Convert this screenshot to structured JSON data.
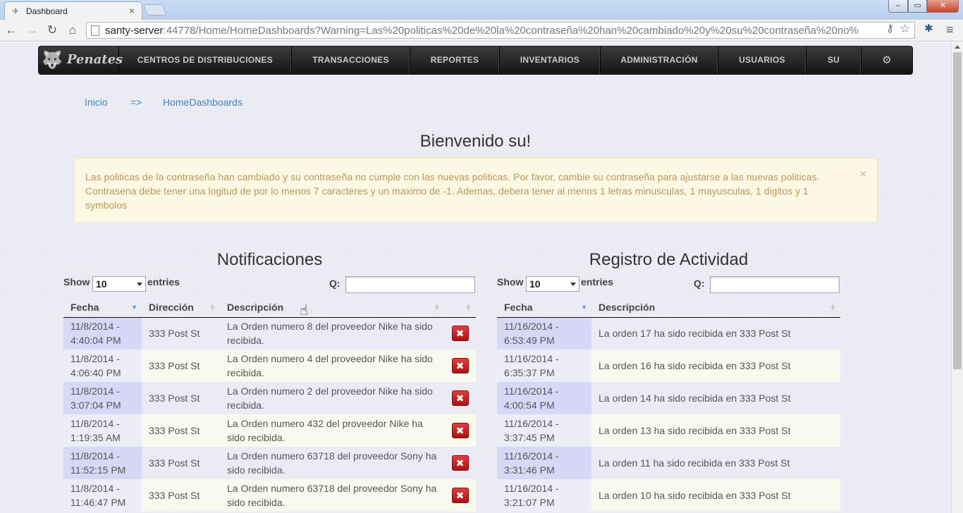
{
  "browser": {
    "tab_title": "Dashboard",
    "tab_close": "×",
    "url_host": "santy-server",
    "url_rest": ":44778/Home/HomeDashboards?Warning=Las%20politicas%20de%20la%20contraseña%20han%20cambiado%20y%20su%20contraseña%20no%",
    "window_buttons": {
      "minimize": "–",
      "maximize": "▭",
      "close": "✕"
    }
  },
  "navbar": {
    "brand": "Penates",
    "items": [
      {
        "label": "CENTROS DE DISTRIBUCIONES"
      },
      {
        "label": "TRANSACCIONES"
      },
      {
        "label": "REPORTES"
      },
      {
        "label": "INVENTARIOS"
      },
      {
        "label": "ADMINISTRACIÓN"
      },
      {
        "label": "USUARIOS"
      },
      {
        "label": "SU"
      }
    ],
    "settings_icon": "⚙"
  },
  "breadcrumb": {
    "home": "Inicio",
    "separator": "=>",
    "current": "HomeDashboards"
  },
  "welcome": "Bienvenido su!",
  "alert": {
    "message": "Las politicas de la contraseña han cambiado y su contraseña no cumple con las nuevas politicas. Por favor, cambie su contraseña para ajustarse a las nuevas politicas. Contrasena debe tener una logitud de por lo menos 7 caracteres y un maximo de -1. Ademas, debera tener al menos 1 letras minusculas, 1 mayusculas, 1 digitos y 1 symbolos",
    "close": "×"
  },
  "notifications": {
    "title": "Notificaciones",
    "show_label": "Show",
    "entries_label": "entries",
    "page_size": "10",
    "search_label": "Q:",
    "columns": [
      "Fecha",
      "Dirección",
      "Descripción"
    ],
    "rows": [
      {
        "fecha": "11/8/2014 - 4:40:04 PM",
        "direccion": "333 Post St",
        "descripcion": "La Orden numero 8 del proveedor Nike ha sido recibida."
      },
      {
        "fecha": "11/8/2014 - 4:06:40 PM",
        "direccion": "333 Post St",
        "descripcion": "La Orden numero 4 del proveedor Nike ha sido recibida."
      },
      {
        "fecha": "11/8/2014 - 3:07:04 PM",
        "direccion": "333 Post St",
        "descripcion": "La Orden numero 2 del proveedor Nike ha sido recibida."
      },
      {
        "fecha": "11/8/2014 - 1:19:35 AM",
        "direccion": "333 Post St",
        "descripcion": "La Orden numero 432 del proveedor Nike ha sido recibida."
      },
      {
        "fecha": "11/8/2014 - 11:52:15 PM",
        "direccion": "333 Post St",
        "descripcion": "La Orden numero 63718 del proveedor Sony ha sido recibida."
      },
      {
        "fecha": "11/8/2014 - 11:46:47 PM",
        "direccion": "333 Post St",
        "descripcion": "La Orden numero 63718 del proveedor Sony ha sido recibida."
      }
    ],
    "delete_icon": "✖"
  },
  "activity": {
    "title": "Registro de Actividad",
    "show_label": "Show",
    "entries_label": "entries",
    "page_size": "10",
    "search_label": "Q:",
    "columns": [
      "Fecha",
      "Descripción"
    ],
    "rows": [
      {
        "fecha": "11/16/2014 - 6:53:49 PM",
        "descripcion": "La orden 17 ha sido recibida en 333 Post St"
      },
      {
        "fecha": "11/16/2014 - 6:35:37 PM",
        "descripcion": "La orden 16 ha sido recibida en 333 Post St"
      },
      {
        "fecha": "11/16/2014 - 4:00:54 PM",
        "descripcion": "La orden 14 ha sido recibida en 333 Post St"
      },
      {
        "fecha": "11/16/2014 - 3:37:45 PM",
        "descripcion": "La orden 13 ha sido recibida en 333 Post St"
      },
      {
        "fecha": "11/16/2014 - 3:31:46 PM",
        "descripcion": "La orden 11 ha sido recibida en 333 Post St"
      },
      {
        "fecha": "11/16/2014 - 3:21:07 PM",
        "descripcion": "La orden 10 ha sido recibida en 333 Post St"
      }
    ]
  }
}
